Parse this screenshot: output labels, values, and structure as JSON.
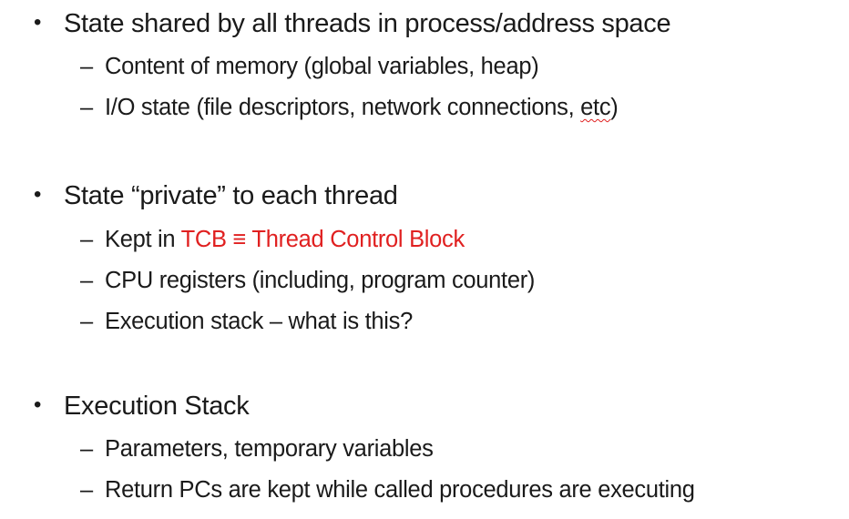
{
  "sections": [
    {
      "heading": "State shared by all threads in process/address space",
      "items": [
        "Content of memory (global variables, heap)",
        {
          "before": "I/O state (file descriptors, network connections, ",
          "flagged": "etc",
          "after": ")"
        }
      ]
    },
    {
      "heading": "State “private” to each thread",
      "items": [
        {
          "plain": "Kept in ",
          "highlight": "TCB ≡ Thread Control Block"
        },
        "CPU registers (including, program counter)",
        "Execution stack – what is this?"
      ]
    },
    {
      "heading": "Execution Stack",
      "items": [
        "Parameters, temporary variables",
        "Return PCs are kept while called procedures are executing"
      ]
    }
  ],
  "symbols": {
    "bullet": "•",
    "dash": "–"
  },
  "colors": {
    "text": "#1a1a1a",
    "highlight": "#e02020",
    "spellcheck_underline": "#e02020"
  }
}
